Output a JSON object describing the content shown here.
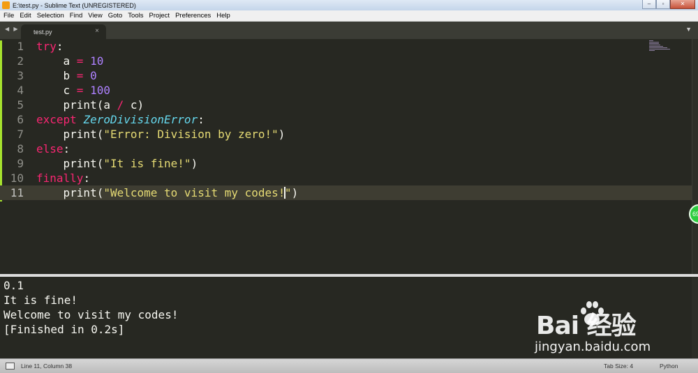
{
  "window": {
    "title": "E:\\test.py - Sublime Text (UNREGISTERED)",
    "buttons": {
      "minimize": "‒",
      "maximize": "▫",
      "close": "✕"
    }
  },
  "menu": [
    "File",
    "Edit",
    "Selection",
    "Find",
    "View",
    "Goto",
    "Tools",
    "Project",
    "Preferences",
    "Help"
  ],
  "tabs": {
    "nav_arrows": "◀ ▶",
    "active_tab": "test.py",
    "close_glyph": "×",
    "dropdown_glyph": "▼"
  },
  "editor": {
    "line_numbers": [
      "1",
      "2",
      "3",
      "4",
      "5",
      "6",
      "7",
      "8",
      "9",
      "10",
      "11"
    ],
    "current_line": 11,
    "gutter_color": "#a6e22e"
  },
  "badge": {
    "text": "69"
  },
  "output": {
    "lines": [
      "0.1",
      "It is fine!",
      "Welcome to visit my codes!",
      "[Finished in 0.2s]"
    ]
  },
  "watermark": {
    "brand": "Bai  经验",
    "site": "jingyan.baidu.com"
  },
  "status": {
    "position": "Line 11, Column 38",
    "tab_size": "Tab Size: 4",
    "syntax": "Python"
  },
  "theme": {
    "keyword": "#f92672",
    "number": "#ae81ff",
    "string": "#e6db74",
    "exception": "#66d9ef",
    "text": "#f8f8f2",
    "background": "#272822"
  }
}
